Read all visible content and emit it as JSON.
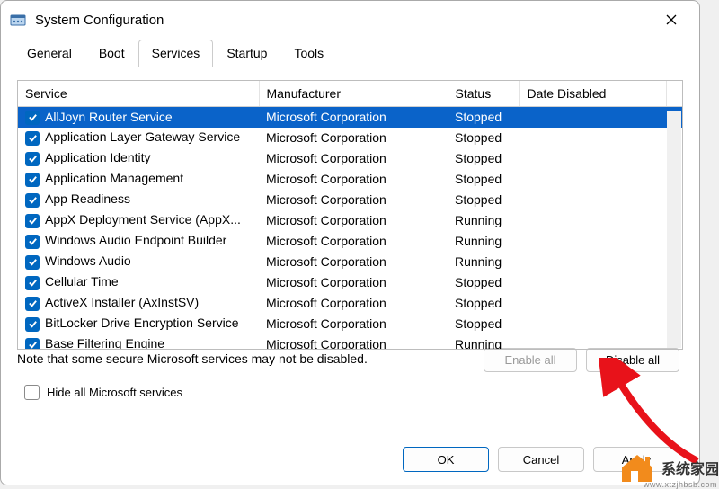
{
  "window": {
    "title": "System Configuration"
  },
  "tabs": {
    "items": [
      {
        "label": "General"
      },
      {
        "label": "Boot"
      },
      {
        "label": "Services"
      },
      {
        "label": "Startup"
      },
      {
        "label": "Tools"
      }
    ],
    "activeIndex": 2
  },
  "columns": {
    "service": "Service",
    "manufacturer": "Manufacturer",
    "status": "Status",
    "dateDisabled": "Date Disabled"
  },
  "rows": [
    {
      "checked": true,
      "selected": true,
      "service": "AllJoyn Router Service",
      "manufacturer": "Microsoft Corporation",
      "status": "Stopped",
      "dateDisabled": ""
    },
    {
      "checked": true,
      "selected": false,
      "service": "Application Layer Gateway Service",
      "manufacturer": "Microsoft Corporation",
      "status": "Stopped",
      "dateDisabled": ""
    },
    {
      "checked": true,
      "selected": false,
      "service": "Application Identity",
      "manufacturer": "Microsoft Corporation",
      "status": "Stopped",
      "dateDisabled": ""
    },
    {
      "checked": true,
      "selected": false,
      "service": "Application Management",
      "manufacturer": "Microsoft Corporation",
      "status": "Stopped",
      "dateDisabled": ""
    },
    {
      "checked": true,
      "selected": false,
      "service": "App Readiness",
      "manufacturer": "Microsoft Corporation",
      "status": "Stopped",
      "dateDisabled": ""
    },
    {
      "checked": true,
      "selected": false,
      "service": "AppX Deployment Service (AppX...",
      "manufacturer": "Microsoft Corporation",
      "status": "Running",
      "dateDisabled": ""
    },
    {
      "checked": true,
      "selected": false,
      "service": "Windows Audio Endpoint Builder",
      "manufacturer": "Microsoft Corporation",
      "status": "Running",
      "dateDisabled": ""
    },
    {
      "checked": true,
      "selected": false,
      "service": "Windows Audio",
      "manufacturer": "Microsoft Corporation",
      "status": "Running",
      "dateDisabled": ""
    },
    {
      "checked": true,
      "selected": false,
      "service": "Cellular Time",
      "manufacturer": "Microsoft Corporation",
      "status": "Stopped",
      "dateDisabled": ""
    },
    {
      "checked": true,
      "selected": false,
      "service": "ActiveX Installer (AxInstSV)",
      "manufacturer": "Microsoft Corporation",
      "status": "Stopped",
      "dateDisabled": ""
    },
    {
      "checked": true,
      "selected": false,
      "service": "BitLocker Drive Encryption Service",
      "manufacturer": "Microsoft Corporation",
      "status": "Stopped",
      "dateDisabled": ""
    },
    {
      "checked": true,
      "selected": false,
      "service": "Base Filtering Engine",
      "manufacturer": "Microsoft Corporation",
      "status": "Running",
      "dateDisabled": ""
    }
  ],
  "note": "Note that some secure Microsoft services may not be disabled.",
  "buttons": {
    "enableAll": "Enable all",
    "disableAll": "Disable all",
    "ok": "OK",
    "cancel": "Cancel",
    "apply": "Apply"
  },
  "hideCheckbox": {
    "checked": false,
    "label": "Hide all Microsoft services"
  },
  "watermark": {
    "text": "系统家园",
    "url": "www.xtzjhbsb.com"
  }
}
